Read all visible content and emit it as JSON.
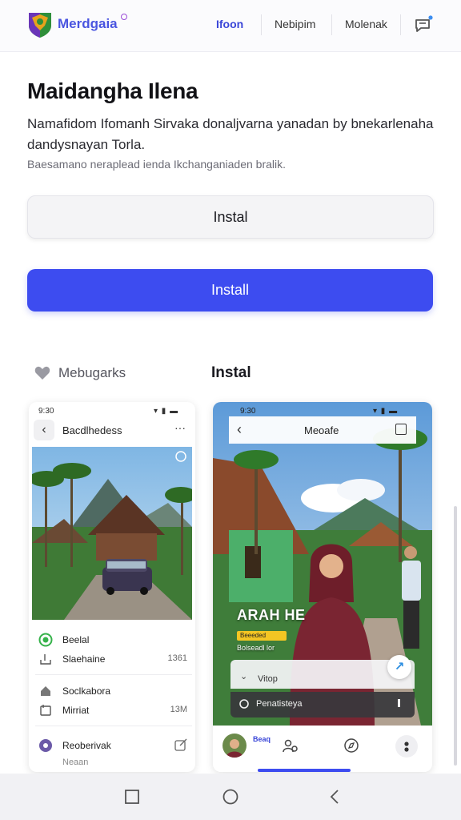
{
  "header": {
    "brand": "Merdgaia",
    "nav": [
      "Ifoon",
      "Nebipim",
      "Molenak"
    ]
  },
  "hero": {
    "title": "Maidangha Ilena",
    "description": "Namafidom Ifomanh Sirvaka donaljvarna yanadan by bnekarlenaha dandysnayan Torla.",
    "subtitle": "Baesamano neraplead ienda Ikchanganiaden bralik."
  },
  "buttons": {
    "secondary": "Instal",
    "primary": "Install"
  },
  "sections": {
    "left_label": "Mebugarks",
    "right_label": "Instal"
  },
  "left_phone": {
    "time": "9:30",
    "title": "Bacdlhedess",
    "rows": [
      {
        "label": "Beelal",
        "value": ""
      },
      {
        "label": "Slaehaine",
        "value": "1361"
      },
      {
        "label": "Soclkabora",
        "value": ""
      },
      {
        "label": "Mirriat",
        "value": "13M"
      },
      {
        "label": "Reoberivak",
        "value": ""
      },
      {
        "label": "Neaan",
        "value": ""
      }
    ]
  },
  "right_phone": {
    "time": "9:30",
    "title": "Meoafe",
    "overlay_title": "ARAH HE",
    "badge": "Beeeded",
    "overlay_line": "Bolseadl lor",
    "sheet_label": "Vitop",
    "bar_label": "Penatisteya",
    "bottom_text": "Beaq"
  },
  "colors": {
    "accent": "#3d4cf0",
    "brand": "#4a55e0"
  },
  "icons": [
    "shield-logo-icon",
    "chat-icon",
    "heart-icon",
    "back-arrow-icon",
    "more-icon",
    "square-icon",
    "check-circle-icon",
    "pause-icon",
    "home-circle-icon",
    "refresh-icon",
    "settings-icon",
    "bell-icon",
    "edit-icon",
    "people-icon",
    "compass-icon",
    "dots-icon",
    "recent-apps-icon",
    "home-icon",
    "back-icon"
  ]
}
